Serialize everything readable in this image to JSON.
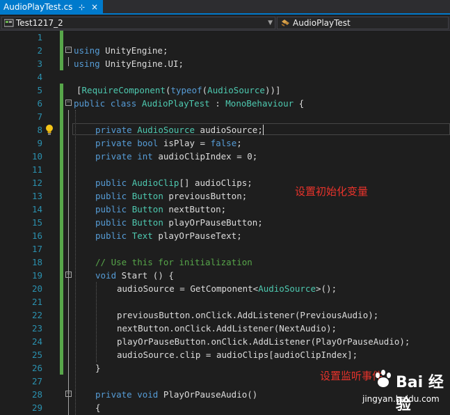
{
  "tab": {
    "title": "AudioPlayTest.cs",
    "pin": "⊹",
    "close": "×"
  },
  "navbar": {
    "project": "Test1217_2",
    "class_name": "AudioPlayTest"
  },
  "lines": [
    "1",
    "2",
    "3",
    "4",
    "5",
    "6",
    "7",
    "8",
    "9",
    "10",
    "11",
    "12",
    "13",
    "14",
    "15",
    "16",
    "17",
    "18",
    "19",
    "20",
    "21",
    "22",
    "23",
    "24",
    "25",
    "26",
    "27",
    "28",
    "29"
  ],
  "code": {
    "l2": [
      "using",
      " UnityEngine;"
    ],
    "l3": [
      "using",
      " UnityEngine.UI;"
    ],
    "l5": [
      "[",
      "RequireComponent",
      "(",
      "typeof",
      "(",
      "AudioSource",
      "))]"
    ],
    "l6": [
      "public",
      " ",
      "class",
      " ",
      "AudioPlayTest",
      " : ",
      "MonoBehaviour",
      " {"
    ],
    "l8": [
      "private",
      " ",
      "AudioSource",
      " audioSource;"
    ],
    "l9": [
      "private",
      " ",
      "bool",
      " isPlay = ",
      "false",
      ";"
    ],
    "l10": [
      "private",
      " ",
      "int",
      " audioClipIndex = 0;"
    ],
    "l12": [
      "public",
      " ",
      "AudioClip",
      "[] audioClips;"
    ],
    "l13": [
      "public",
      " ",
      "Button",
      " previousButton;"
    ],
    "l14": [
      "public",
      " ",
      "Button",
      " nextButton;"
    ],
    "l15": [
      "public",
      " ",
      "Button",
      " playOrPauseButton;"
    ],
    "l16": [
      "public",
      " ",
      "Text",
      " playOrPauseText;"
    ],
    "l18": "// Use this for initialization",
    "l19": [
      "void",
      " Start () {"
    ],
    "l20": [
      "audioSource = GetComponent<",
      "AudioSource",
      ">();"
    ],
    "l22": "previousButton.onClick.AddListener(PreviousAudio);",
    "l23": "nextButton.onClick.AddListener(NextAudio);",
    "l24": "playOrPauseButton.onClick.AddListener(PlayOrPauseAudio);",
    "l25": "audioSource.clip = audioClips[audioClipIndex];",
    "l26": "}",
    "l28": [
      "private",
      " ",
      "void",
      " PlayOrPauseAudio()"
    ],
    "l29": "{"
  },
  "annotations": {
    "init_vars": "设置初始化变量",
    "listen_events": "设置监听事件"
  },
  "watermark": {
    "logo": "Bai 经验",
    "url": "jingyan.baidu.com"
  },
  "colors": {
    "keyword": "#569cd6",
    "type": "#4ec9b0",
    "comment": "#57a64a",
    "linenum": "#2b91af",
    "accent": "#007acc",
    "annotation": "#e8332b"
  }
}
